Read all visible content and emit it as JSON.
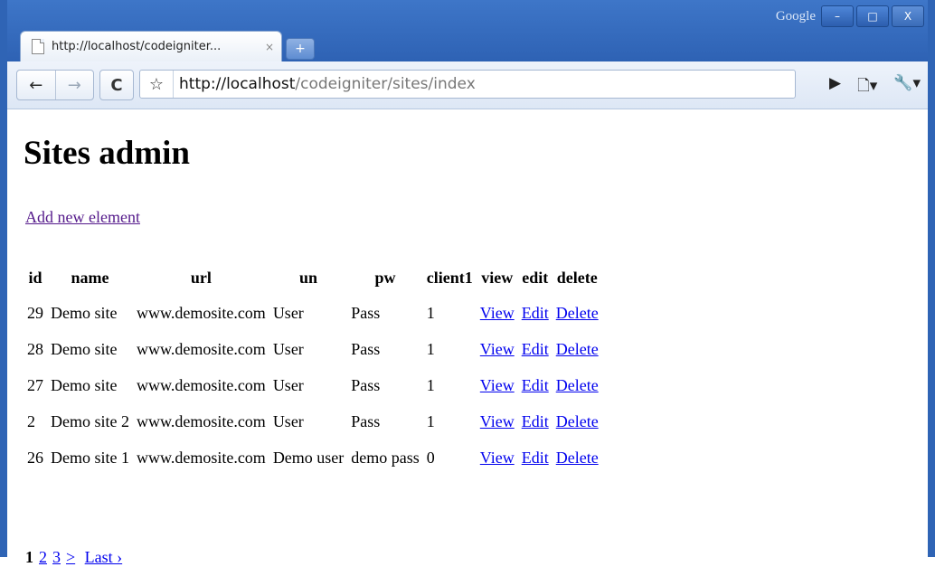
{
  "window": {
    "search_brand": "Google",
    "buttons": [
      "–",
      "□",
      "X"
    ]
  },
  "tab": {
    "title": "http://localhost/codeigniter...",
    "close_glyph": "×",
    "newtab_glyph": "+"
  },
  "toolbar": {
    "back_glyph": "←",
    "forward_glyph": "→",
    "reload_glyph": "C",
    "star_glyph": "☆",
    "url_host": "http://localhost",
    "url_path": "/codeigniter/sites/index",
    "go_glyph": "▶",
    "page_menu_glyph": "🗋▾",
    "wrench_glyph": "🔧▾"
  },
  "page": {
    "title": "Sites admin",
    "add_link": "Add new element"
  },
  "table": {
    "headers": [
      "id",
      "name",
      "url",
      "un",
      "pw",
      "client1",
      "view",
      "edit",
      "delete"
    ],
    "rows": [
      [
        "29",
        "Demo site",
        "www.demosite.com",
        "User",
        "Pass",
        "1",
        "View",
        "Edit",
        "Delete"
      ],
      [
        "28",
        "Demo site",
        "www.demosite.com",
        "User",
        "Pass",
        "1",
        "View",
        "Edit",
        "Delete"
      ],
      [
        "27",
        "Demo site",
        "www.demosite.com",
        "User",
        "Pass",
        "1",
        "View",
        "Edit",
        "Delete"
      ],
      [
        "2",
        "Demo site 2",
        "www.demosite.com",
        "User",
        "Pass",
        "1",
        "View",
        "Edit",
        "Delete"
      ],
      [
        "26",
        "Demo site 1",
        "www.demosite.com",
        "Demo user",
        "demo pass",
        "0",
        "View",
        "Edit",
        "Delete"
      ]
    ]
  },
  "pagination": {
    "current": "1",
    "pages": [
      "2",
      "3"
    ],
    "next": ">",
    "last": "Last ›"
  }
}
